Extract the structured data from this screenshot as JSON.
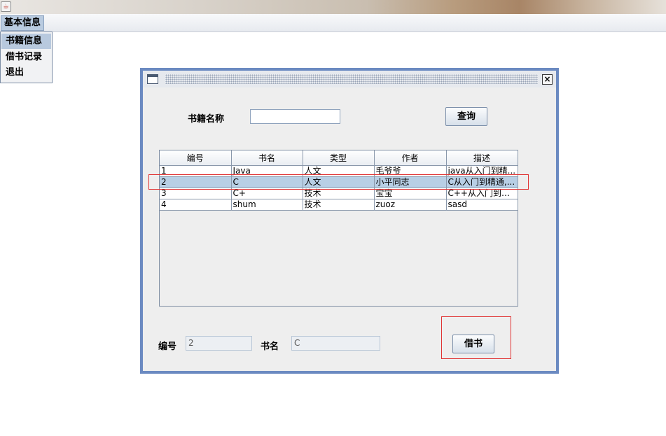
{
  "menubar": {
    "top_menu": "基本信息",
    "items": [
      {
        "label": "书籍信息",
        "selected": true
      },
      {
        "label": "借书记录",
        "selected": false
      },
      {
        "label": "退出",
        "selected": false
      }
    ]
  },
  "dialog": {
    "search": {
      "label": "书籍名称",
      "value": "",
      "button": "查询"
    },
    "table": {
      "columns": [
        "编号",
        "书名",
        "类型",
        "作者",
        "描述"
      ],
      "rows": [
        [
          "1",
          "Java",
          "人文",
          "毛爷爷",
          "java从入门到精..."
        ],
        [
          "2",
          "C",
          "人文",
          "小平同志",
          "C从入门到精通,..."
        ],
        [
          "3",
          "C+",
          "技术",
          "宝宝",
          "C++从入门到精..."
        ],
        [
          "4",
          "shum",
          "技术",
          "zuoz",
          "sasd"
        ]
      ],
      "selected_row": 1
    },
    "form": {
      "id_label": "编号",
      "id_value": "2",
      "name_label": "书名",
      "name_value": "C",
      "borrow_button": "借书"
    }
  },
  "colors": {
    "dialog_border": "#6b8ac1",
    "selection": "#b8cfe5",
    "highlight_box": "#e03434"
  }
}
